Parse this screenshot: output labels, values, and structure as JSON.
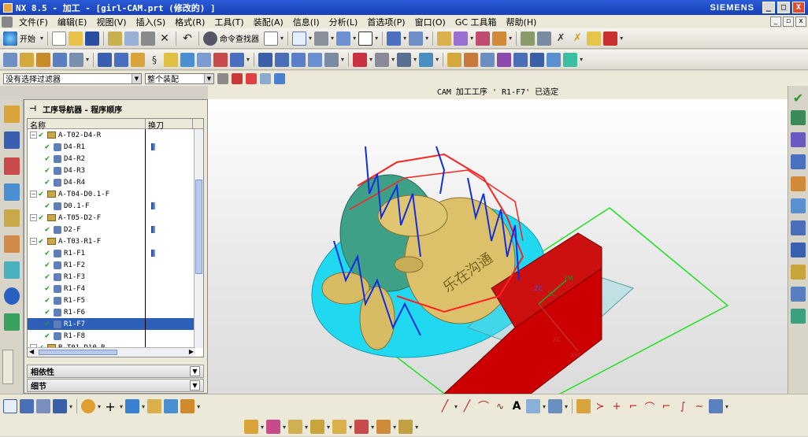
{
  "window": {
    "title": "NX 8.5 - 加工 - [girl-CAM.prt (修改的) ]",
    "brand": "SIEMENS",
    "min": "_",
    "max": "□",
    "close": "X"
  },
  "menu": {
    "items": [
      "文件(F)",
      "编辑(E)",
      "视图(V)",
      "插入(S)",
      "格式(R)",
      "工具(T)",
      "装配(A)",
      "信息(I)",
      "分析(L)",
      "首选项(P)",
      "窗口(O)",
      "GC 工具箱",
      "帮助(H)"
    ]
  },
  "toolbar": {
    "start_label": "开始",
    "command_finder_label": "命令查找器"
  },
  "selection": {
    "filter_value": "没有选择过滤器",
    "scope_value": "整个装配"
  },
  "status_text": "CAM 加工工序 ' R1-F7' 已选定",
  "navigator": {
    "title": "工序导航器 - 程序顺序",
    "col_name": "名称",
    "col_tool": "换刀",
    "rows": [
      {
        "name": "A-T02-D4-R",
        "level": 0,
        "group": true,
        "tool": false,
        "selected": false
      },
      {
        "name": "D4-R1",
        "level": 1,
        "group": false,
        "tool": true,
        "selected": false
      },
      {
        "name": "D4-R2",
        "level": 1,
        "group": false,
        "tool": false,
        "selected": false
      },
      {
        "name": "D4-R3",
        "level": 1,
        "group": false,
        "tool": false,
        "selected": false
      },
      {
        "name": "D4-R4",
        "level": 1,
        "group": false,
        "tool": false,
        "selected": false
      },
      {
        "name": "A-T04-D0.1-F",
        "level": 0,
        "group": true,
        "tool": false,
        "selected": false
      },
      {
        "name": "D0.1-F",
        "level": 1,
        "group": false,
        "tool": true,
        "selected": false
      },
      {
        "name": "A-T05-D2-F",
        "level": 0,
        "group": true,
        "tool": false,
        "selected": false
      },
      {
        "name": "D2-F",
        "level": 1,
        "group": false,
        "tool": true,
        "selected": false
      },
      {
        "name": "A-T03-R1-F",
        "level": 0,
        "group": true,
        "tool": false,
        "selected": false
      },
      {
        "name": "R1-F1",
        "level": 1,
        "group": false,
        "tool": true,
        "selected": false
      },
      {
        "name": "R1-F2",
        "level": 1,
        "group": false,
        "tool": false,
        "selected": false
      },
      {
        "name": "R1-F3",
        "level": 1,
        "group": false,
        "tool": false,
        "selected": false
      },
      {
        "name": "R1-F4",
        "level": 1,
        "group": false,
        "tool": false,
        "selected": false
      },
      {
        "name": "R1-F5",
        "level": 1,
        "group": false,
        "tool": false,
        "selected": false
      },
      {
        "name": "R1-F6",
        "level": 1,
        "group": false,
        "tool": false,
        "selected": false
      },
      {
        "name": "R1-F7",
        "level": 1,
        "group": false,
        "tool": false,
        "selected": true
      },
      {
        "name": "R1-F8",
        "level": 1,
        "group": false,
        "tool": false,
        "selected": false
      },
      {
        "name": "B-T01-D10-R",
        "level": 0,
        "group": true,
        "tool": false,
        "selected": false
      }
    ],
    "panel_dependencies": "相依性",
    "panel_details": "细节"
  },
  "viewport": {
    "engraving": "乐在沟通",
    "axis_labels": {
      "ym": "YM",
      "yc": "YC",
      "xc": "XC",
      "xm": "XM",
      "zc": "ZC"
    }
  }
}
